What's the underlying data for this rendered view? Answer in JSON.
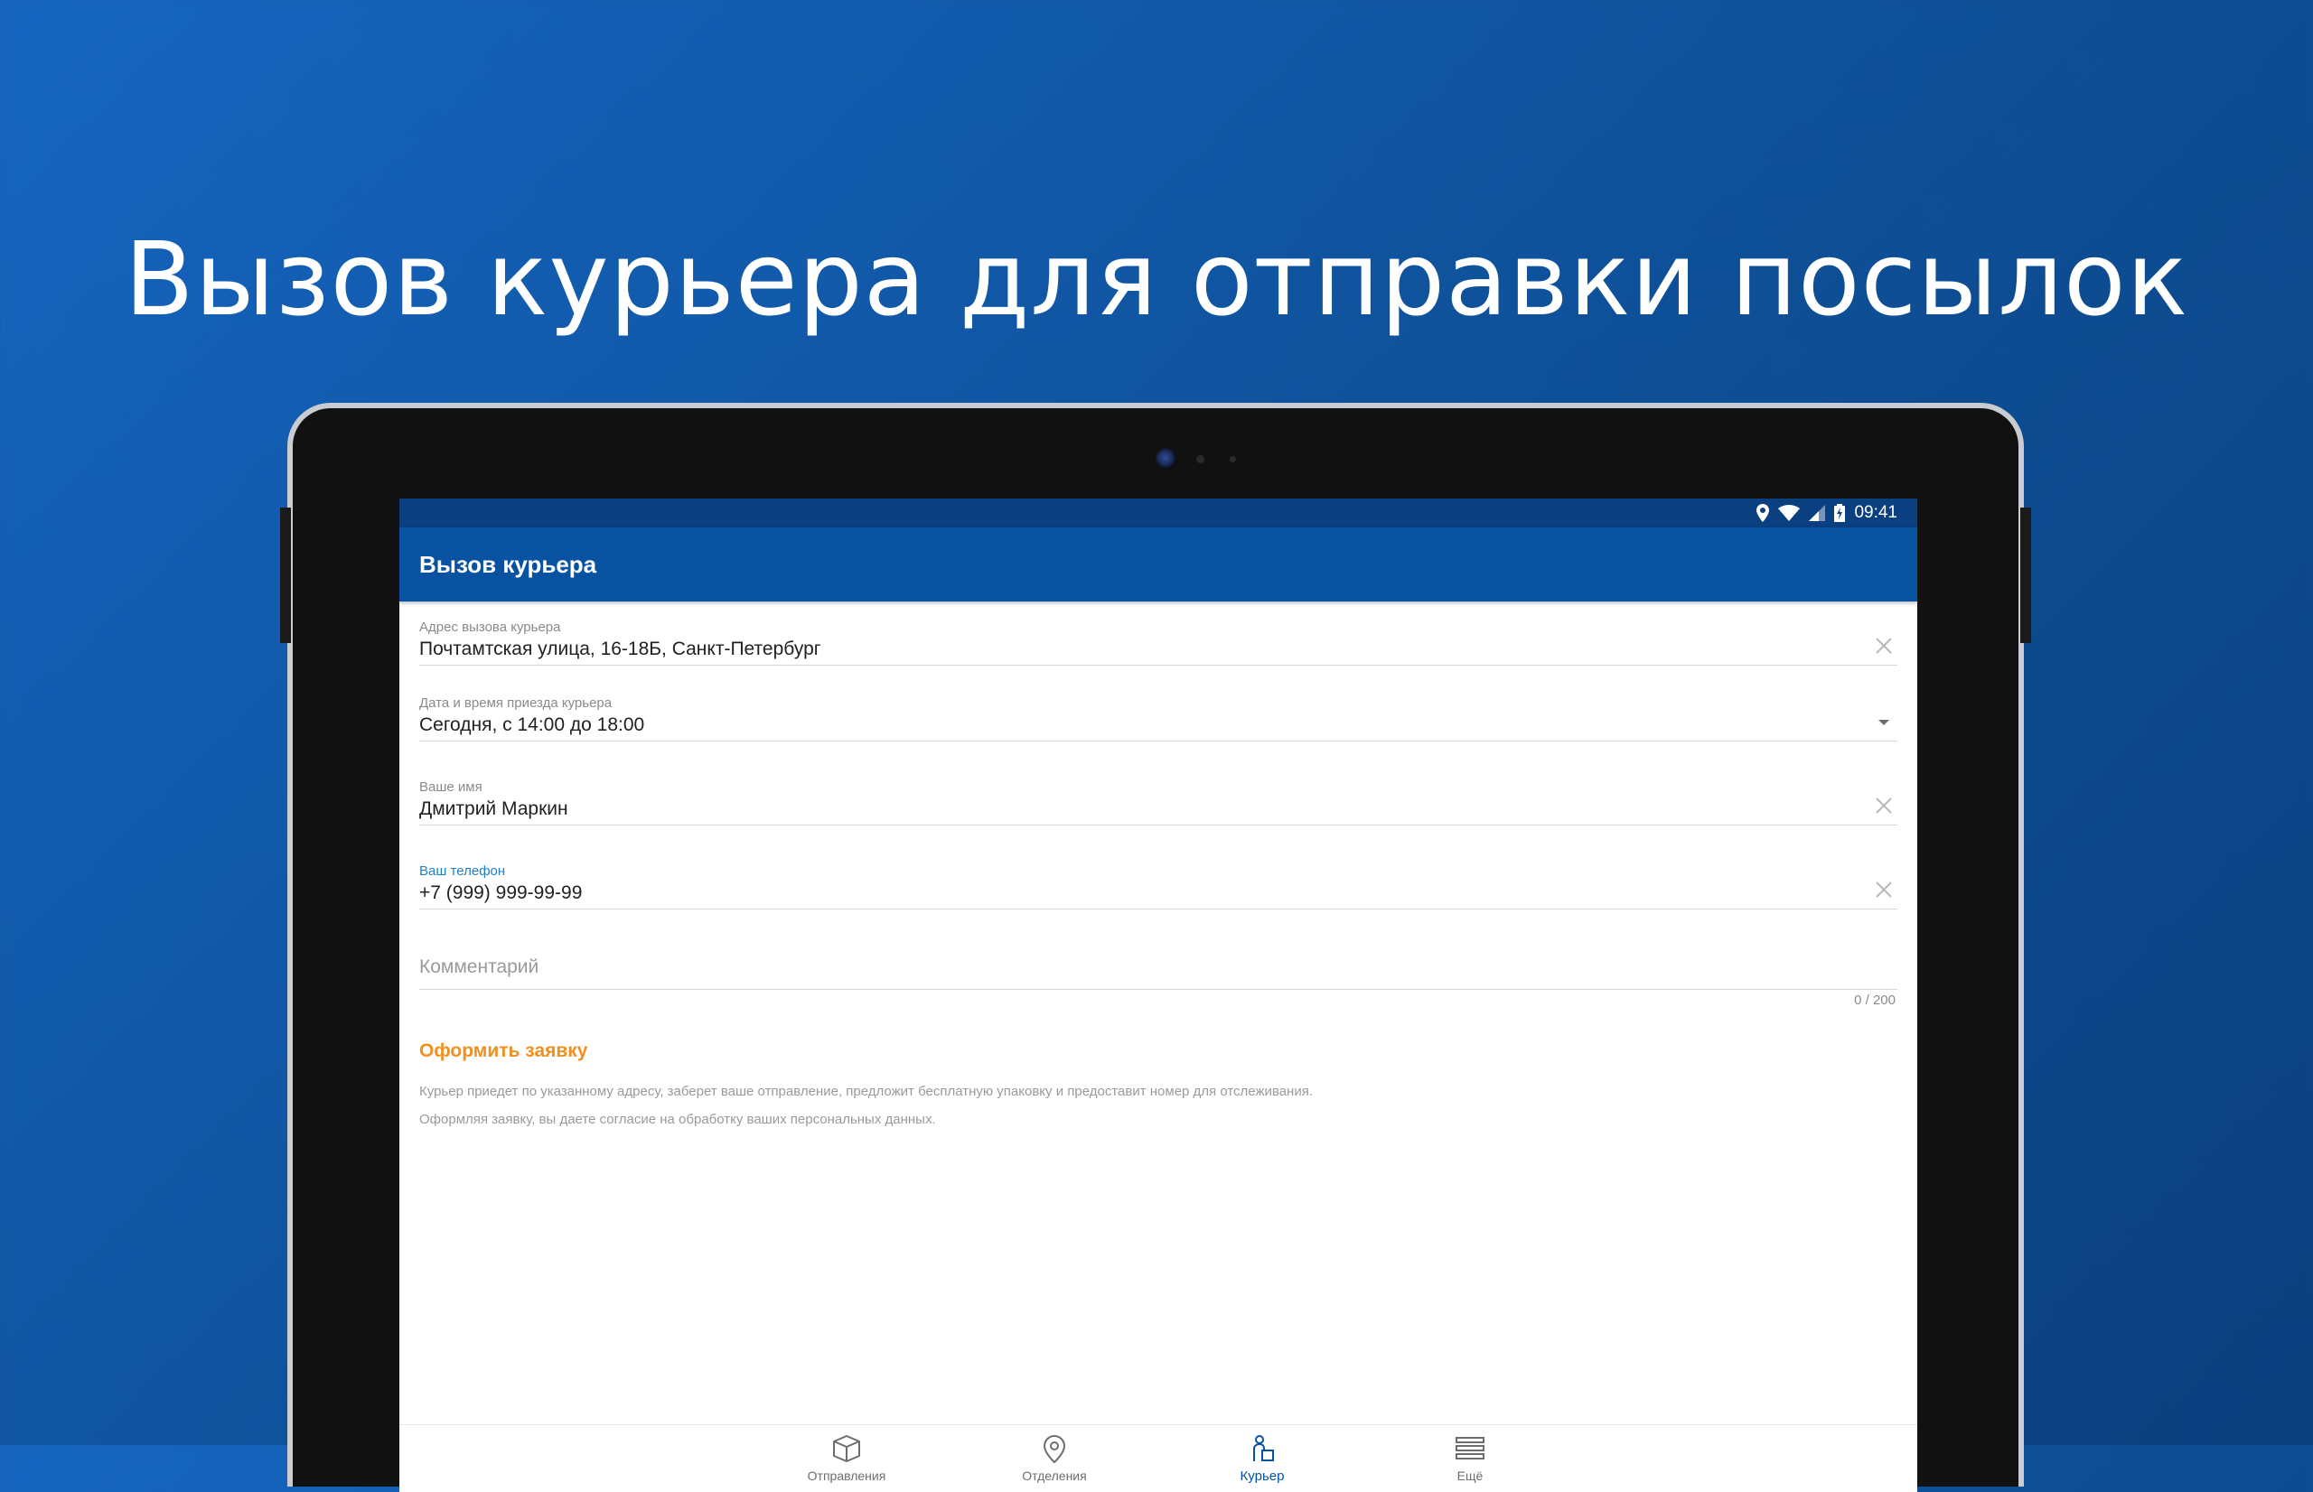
{
  "promo": {
    "title": "Вызов курьера для отправки посылок"
  },
  "status_bar": {
    "time": "09:41",
    "icons": [
      "location-icon",
      "wifi-icon",
      "signal-icon",
      "battery-charging-icon"
    ]
  },
  "app_bar": {
    "title": "Вызов курьера"
  },
  "form": {
    "address": {
      "label": "Адрес вызова курьера",
      "value": "Почтамтская улица, 16-18Б, Санкт-Петербург",
      "end_icon": "clear-icon"
    },
    "datetime": {
      "label": "Дата и время приезда курьера",
      "value": "Сегодня, с 14:00 до 18:00",
      "end_icon": "dropdown-arrow-icon"
    },
    "name": {
      "label": "Ваше имя",
      "value": "Дмитрий Маркин",
      "end_icon": "clear-icon"
    },
    "phone": {
      "label": "Ваш телефон",
      "value": "+7 (999) 999-99-99",
      "end_icon": "clear-icon"
    },
    "comment": {
      "placeholder": "Комментарий",
      "counter": "0 / 200"
    },
    "submit_label": "Оформить заявку",
    "notes": [
      "Курьер приедет по указанному адресу, заберет ваше отправление, предложит бесплатную упаковку и предоставит номер для отслеживания.",
      "Оформляя заявку, вы даете согласие на обработку ваших персональных данных."
    ]
  },
  "bottom_nav": {
    "items": [
      {
        "label": "Отправления",
        "icon": "parcel-icon",
        "active": false
      },
      {
        "label": "Отделения",
        "icon": "map-pin-icon",
        "active": false
      },
      {
        "label": "Курьер",
        "icon": "courier-icon",
        "active": true
      },
      {
        "label": "Ещё",
        "icon": "menu-icon",
        "active": false
      }
    ]
  },
  "colors": {
    "background": "#1565c0",
    "app_bar": "#0753a2",
    "status_bar": "#0a3f80",
    "accent_orange": "#f0901e",
    "active_label_blue": "#1e7fc8"
  }
}
